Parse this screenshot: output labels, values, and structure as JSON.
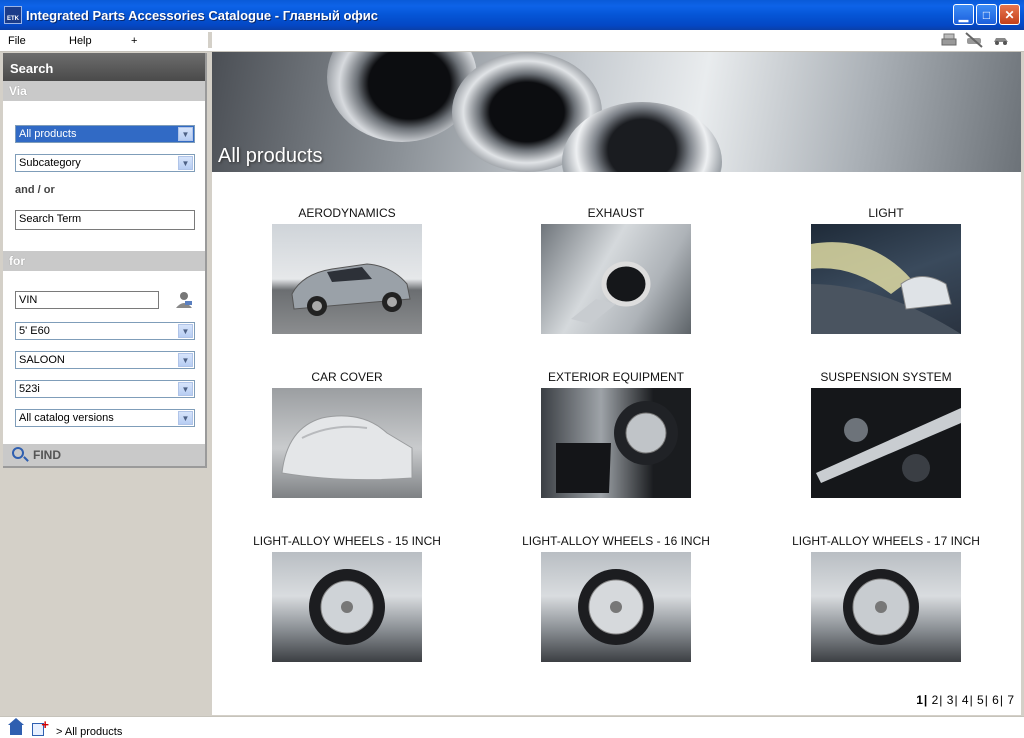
{
  "window": {
    "title": "Integrated Parts Accessories Catalogue - Главный офис",
    "icon_text": "ETK",
    "controls": [
      "minimize-icon",
      "maximize-icon",
      "close-icon"
    ]
  },
  "menu": {
    "items": [
      "File",
      "Help",
      "+"
    ],
    "tools": [
      "print-icon",
      "no-vehicle-icon",
      "car-icon"
    ]
  },
  "sidebar": {
    "title": "Search",
    "via_label": "Via",
    "product_select": "All products",
    "subcategory_select": "Subcategory",
    "and_or": "and / or",
    "search_term": "Search Term",
    "for_label": "for",
    "vin": "VIN",
    "series_select": "5' E60",
    "body_select": "SALOON",
    "model_select": "523i",
    "catalog_select": "All catalog versions",
    "find_label": "FIND"
  },
  "banner": {
    "title": "All products"
  },
  "categories": [
    {
      "label": "AERODYNAMICS",
      "image": "car-coupe"
    },
    {
      "label": "EXHAUST",
      "image": "exhaust-pipe"
    },
    {
      "label": "LIGHT",
      "image": "headlight-beam"
    },
    {
      "label": "CAR COVER",
      "image": "covered-car"
    },
    {
      "label": "EXTERIOR EQUIPMENT",
      "image": "mudflap-wheel"
    },
    {
      "label": "SUSPENSION SYSTEM",
      "image": "strut-brace"
    },
    {
      "label": "LIGHT-ALLOY WHEELS - 15 INCH",
      "image": "alloy-wheel"
    },
    {
      "label": "LIGHT-ALLOY WHEELS - 16 INCH",
      "image": "alloy-wheel"
    },
    {
      "label": "LIGHT-ALLOY WHEELS - 17 INCH",
      "image": "alloy-wheel"
    }
  ],
  "pager": {
    "pages": [
      "1",
      "2",
      "3",
      "4",
      "5",
      "6",
      "7"
    ],
    "current": "1"
  },
  "status": {
    "breadcrumb": "> All products"
  }
}
